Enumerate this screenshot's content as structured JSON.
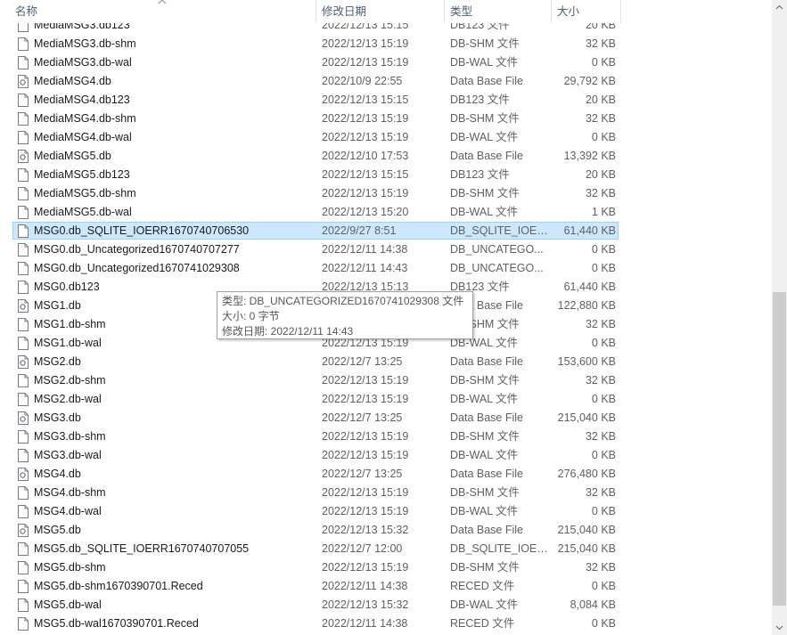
{
  "columns": {
    "name": "名称",
    "date": "修改日期",
    "type": "类型",
    "size": "大小"
  },
  "icons": {
    "document": "document-icon",
    "database": "database-file-icon",
    "sort": "sort-ascending-icon"
  },
  "files": [
    {
      "name": "MediaMSG3.db123",
      "date": "2022/12/13 15:15",
      "type": "DB123 文件",
      "size": "20 KB",
      "icon": "document"
    },
    {
      "name": "MediaMSG3.db-shm",
      "date": "2022/12/13 15:19",
      "type": "DB-SHM 文件",
      "size": "32 KB",
      "icon": "document"
    },
    {
      "name": "MediaMSG3.db-wal",
      "date": "2022/12/13 15:19",
      "type": "DB-WAL 文件",
      "size": "0 KB",
      "icon": "document"
    },
    {
      "name": "MediaMSG4.db",
      "date": "2022/10/9 22:55",
      "type": "Data Base File",
      "size": "29,792 KB",
      "icon": "database"
    },
    {
      "name": "MediaMSG4.db123",
      "date": "2022/12/13 15:15",
      "type": "DB123 文件",
      "size": "20 KB",
      "icon": "document"
    },
    {
      "name": "MediaMSG4.db-shm",
      "date": "2022/12/13 15:19",
      "type": "DB-SHM 文件",
      "size": "32 KB",
      "icon": "document"
    },
    {
      "name": "MediaMSG4.db-wal",
      "date": "2022/12/13 15:19",
      "type": "DB-WAL 文件",
      "size": "0 KB",
      "icon": "document"
    },
    {
      "name": "MediaMSG5.db",
      "date": "2022/12/10 17:53",
      "type": "Data Base File",
      "size": "13,392 KB",
      "icon": "database"
    },
    {
      "name": "MediaMSG5.db123",
      "date": "2022/12/13 15:15",
      "type": "DB123 文件",
      "size": "20 KB",
      "icon": "document"
    },
    {
      "name": "MediaMSG5.db-shm",
      "date": "2022/12/13 15:19",
      "type": "DB-SHM 文件",
      "size": "32 KB",
      "icon": "document"
    },
    {
      "name": "MediaMSG5.db-wal",
      "date": "2022/12/13 15:20",
      "type": "DB-WAL 文件",
      "size": "1 KB",
      "icon": "document"
    },
    {
      "name": "MSG0.db_SQLITE_IOERR1670740706530",
      "date": "2022/9/27 8:51",
      "type": "DB_SQLITE_IOER...",
      "size": "61,440 KB",
      "icon": "document",
      "selected": true
    },
    {
      "name": "MSG0.db_Uncategorized1670740707277",
      "date": "2022/12/11 14:38",
      "type": "DB_UNCATEGO...",
      "size": "0 KB",
      "icon": "document"
    },
    {
      "name": "MSG0.db_Uncategorized1670741029308",
      "date": "2022/12/11 14:43",
      "type": "DB_UNCATEGO...",
      "size": "0 KB",
      "icon": "document"
    },
    {
      "name": "MSG0.db123",
      "date": "2022/12/13 15:13",
      "type": "DB123 文件",
      "size": "61,440 KB",
      "icon": "document"
    },
    {
      "name": "MSG1.db",
      "date": "",
      "type": "Data Base File",
      "size": "122,880 KB",
      "icon": "database"
    },
    {
      "name": "MSG1.db-shm",
      "date": "",
      "type": "DB-SHM 文件",
      "size": "32 KB",
      "icon": "document"
    },
    {
      "name": "MSG1.db-wal",
      "date": "2022/12/13 15:19",
      "type": "DB-WAL 文件",
      "size": "0 KB",
      "icon": "document"
    },
    {
      "name": "MSG2.db",
      "date": "2022/12/7 13:25",
      "type": "Data Base File",
      "size": "153,600 KB",
      "icon": "database"
    },
    {
      "name": "MSG2.db-shm",
      "date": "2022/12/13 15:19",
      "type": "DB-SHM 文件",
      "size": "32 KB",
      "icon": "document"
    },
    {
      "name": "MSG2.db-wal",
      "date": "2022/12/13 15:19",
      "type": "DB-WAL 文件",
      "size": "0 KB",
      "icon": "document"
    },
    {
      "name": "MSG3.db",
      "date": "2022/12/7 13:25",
      "type": "Data Base File",
      "size": "215,040 KB",
      "icon": "database"
    },
    {
      "name": "MSG3.db-shm",
      "date": "2022/12/13 15:19",
      "type": "DB-SHM 文件",
      "size": "32 KB",
      "icon": "document"
    },
    {
      "name": "MSG3.db-wal",
      "date": "2022/12/13 15:19",
      "type": "DB-WAL 文件",
      "size": "0 KB",
      "icon": "document"
    },
    {
      "name": "MSG4.db",
      "date": "2022/12/7 13:25",
      "type": "Data Base File",
      "size": "276,480 KB",
      "icon": "database"
    },
    {
      "name": "MSG4.db-shm",
      "date": "2022/12/13 15:19",
      "type": "DB-SHM 文件",
      "size": "32 KB",
      "icon": "document"
    },
    {
      "name": "MSG4.db-wal",
      "date": "2022/12/13 15:19",
      "type": "DB-WAL 文件",
      "size": "0 KB",
      "icon": "document"
    },
    {
      "name": "MSG5.db",
      "date": "2022/12/13 15:32",
      "type": "Data Base File",
      "size": "215,040 KB",
      "icon": "database"
    },
    {
      "name": "MSG5.db_SQLITE_IOERR1670740707055",
      "date": "2022/12/7 12:00",
      "type": "DB_SQLITE_IOER...",
      "size": "215,040 KB",
      "icon": "document"
    },
    {
      "name": "MSG5.db-shm",
      "date": "2022/12/13 15:19",
      "type": "DB-SHM 文件",
      "size": "32 KB",
      "icon": "document"
    },
    {
      "name": "MSG5.db-shm1670390701.Reced",
      "date": "2022/12/11 14:38",
      "type": "RECED 文件",
      "size": "0 KB",
      "icon": "document"
    },
    {
      "name": "MSG5.db-wal",
      "date": "2022/12/13 15:32",
      "type": "DB-WAL 文件",
      "size": "8,084 KB",
      "icon": "document"
    },
    {
      "name": "MSG5.db-wal1670390701.Reced",
      "date": "2022/12/11 14:38",
      "type": "RECED 文件",
      "size": "0 KB",
      "icon": "document"
    }
  ],
  "tooltip": {
    "type_line": "类型: DB_UNCATEGORIZED1670741029308 文件",
    "size_line": "大小: 0 字节",
    "date_line": "修改日期: 2022/12/11 14:43"
  },
  "scrollbar": {
    "position": 0.95
  }
}
